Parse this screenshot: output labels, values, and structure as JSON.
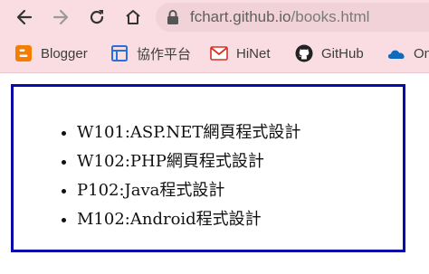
{
  "browser": {
    "url_domain": "fchart.github.io",
    "url_path": "/books.html",
    "colors": {
      "toolbar_bg": "#f9dde3",
      "frame_border": "#0a0aa8"
    }
  },
  "toolbar": {
    "back_icon": "arrow-left-icon",
    "forward_icon": "arrow-right-icon",
    "reload_icon": "reload-icon",
    "home_icon": "home-icon",
    "site_info_icon": "lock-icon"
  },
  "bookmarks": [
    {
      "label": "Blogger",
      "icon": "blogger-icon"
    },
    {
      "label": "協作平台",
      "icon": "sites-icon"
    },
    {
      "label": "HiNet",
      "icon": "mail-icon"
    },
    {
      "label": "GitHub",
      "icon": "github-icon"
    },
    {
      "label": "On",
      "icon": "onedrive-icon"
    }
  ],
  "page": {
    "books": [
      "W101:ASP.NET網頁程式設計",
      "W102:PHP網頁程式設計",
      "P102:Java程式設計",
      "M102:Android程式設計"
    ]
  }
}
